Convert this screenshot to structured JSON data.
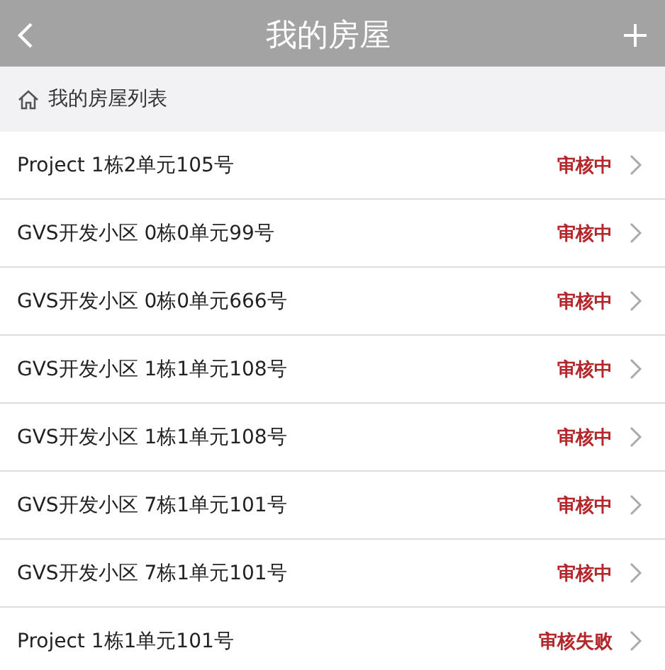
{
  "header": {
    "title": "我的房屋"
  },
  "breadcrumb": {
    "label": "我的房屋列表"
  },
  "houses": [
    {
      "address": "Project 1栋2单元105号",
      "status": "审核中"
    },
    {
      "address": "GVS开发小区 0栋0单元99号",
      "status": "审核中"
    },
    {
      "address": "GVS开发小区 0栋0单元666号",
      "status": "审核中"
    },
    {
      "address": "GVS开发小区 1栋1单元108号",
      "status": "审核中"
    },
    {
      "address": "GVS开发小区 1栋1单元108号",
      "status": "审核中"
    },
    {
      "address": "GVS开发小区 7栋1单元101号",
      "status": "审核中"
    },
    {
      "address": "GVS开发小区 7栋1单元101号",
      "status": "审核中"
    },
    {
      "address": "Project 1栋1单元101号",
      "status": "审核失败"
    }
  ]
}
